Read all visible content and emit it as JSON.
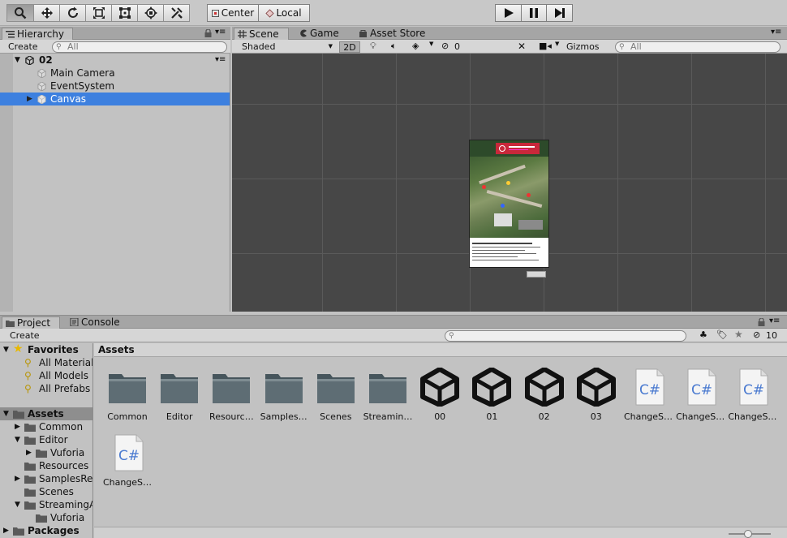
{
  "toolbar": {
    "tools": [
      "hand-tool",
      "move-tool",
      "rotate-tool",
      "scale-tool",
      "rect-tool",
      "transform-tool",
      "custom-tool"
    ],
    "pivot_center": "Center",
    "pivot_local": "Local",
    "play": "play",
    "pause": "pause",
    "step": "step"
  },
  "hierarchy": {
    "tab": "Hierarchy",
    "create": "Create",
    "search_placeholder": "All",
    "scene_name": "02",
    "items": [
      {
        "label": "Main Camera"
      },
      {
        "label": "EventSystem"
      },
      {
        "label": "Canvas"
      }
    ]
  },
  "scene_view": {
    "tabs": [
      "Scene",
      "Game",
      "Asset Store"
    ],
    "shading": "Shaded",
    "mode_2d": "2D",
    "hidden_count": "0",
    "gizmos": "Gizmos",
    "search_placeholder": "All"
  },
  "project": {
    "tabs": [
      "Project",
      "Console"
    ],
    "create": "Create",
    "hidden_count": "10",
    "breadcrumb": "Assets",
    "favorites_label": "Favorites",
    "favorites": [
      "All Materials",
      "All Models",
      "All Prefabs"
    ],
    "assets_label": "Assets",
    "tree": [
      {
        "label": "Common",
        "indent": 1,
        "arrow": "right"
      },
      {
        "label": "Editor",
        "indent": 1,
        "arrow": "down"
      },
      {
        "label": "Vuforia",
        "indent": 2,
        "arrow": "right"
      },
      {
        "label": "Resources",
        "indent": 1,
        "arrow": "none"
      },
      {
        "label": "SamplesRes",
        "indent": 1,
        "arrow": "right"
      },
      {
        "label": "Scenes",
        "indent": 1,
        "arrow": "none"
      },
      {
        "label": "StreamingA",
        "indent": 1,
        "arrow": "down"
      },
      {
        "label": "Vuforia",
        "indent": 2,
        "arrow": "none"
      }
    ],
    "packages_label": "Packages",
    "grid_items": [
      {
        "label": "Common",
        "kind": "folder"
      },
      {
        "label": "Editor",
        "kind": "folder"
      },
      {
        "label": "Resourc…",
        "kind": "folder"
      },
      {
        "label": "Samples…",
        "kind": "folder"
      },
      {
        "label": "Scenes",
        "kind": "folder"
      },
      {
        "label": "Streamin…",
        "kind": "folder"
      },
      {
        "label": "00",
        "kind": "unity"
      },
      {
        "label": "01",
        "kind": "unity"
      },
      {
        "label": "02",
        "kind": "unity"
      },
      {
        "label": "03",
        "kind": "unity"
      },
      {
        "label": "ChangeS…",
        "kind": "cs"
      },
      {
        "label": "ChangeS…",
        "kind": "cs"
      },
      {
        "label": "ChangeS…",
        "kind": "cs"
      },
      {
        "label": "ChangeS…",
        "kind": "cs"
      }
    ],
    "cs_text": "C#"
  },
  "colors": {
    "selection": "#3d80df",
    "scene_bg": "#474747",
    "panel_bg": "#c2c2c2"
  }
}
